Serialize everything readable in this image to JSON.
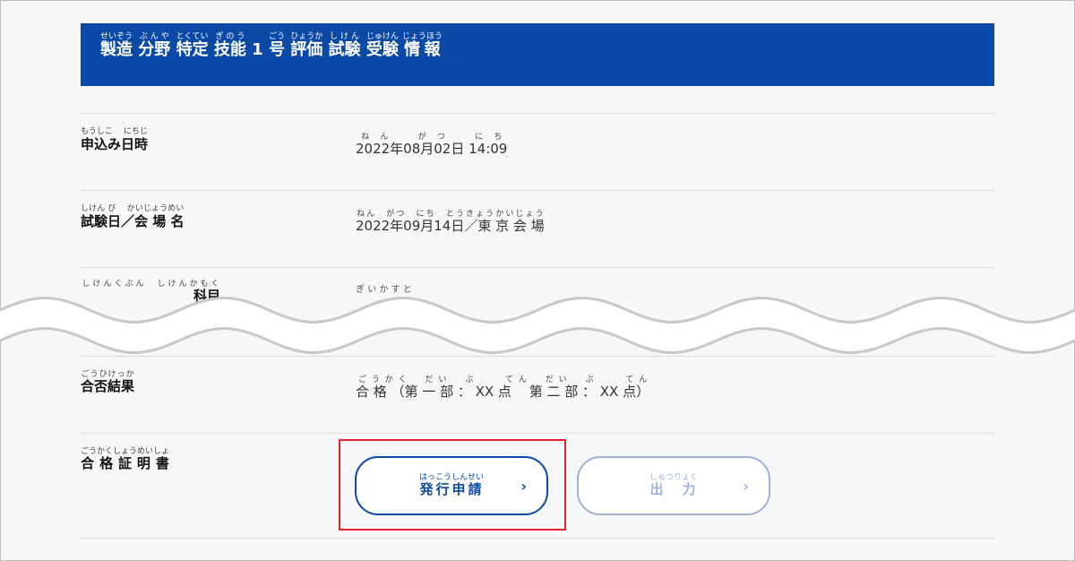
{
  "header": {
    "title_parts": [
      {
        "base": "製造",
        "rt": "せいぞう"
      },
      {
        "base": "分野",
        "rt": "ぶんや"
      },
      {
        "base": "特定",
        "rt": "とくてい"
      },
      {
        "base": "技能",
        "rt": "ぎのう"
      },
      {
        "base": "1"
      },
      {
        "base": "号",
        "rt": "ごう"
      },
      {
        "base": "評価",
        "rt": "ひょうか"
      },
      {
        "base": "試験",
        "rt": "しけん"
      },
      {
        "base": "受験",
        "rt": "じゅけん"
      },
      {
        "base": "情報",
        "rt": "じょうほう"
      }
    ]
  },
  "rows": {
    "application": {
      "label": "申込み日時",
      "label_rt": "もうしこ　 にちじ",
      "value_text": "2022年08月02日 14:09",
      "value_rt": "ねん　がつ　にち"
    },
    "exam_venue": {
      "label": "試験日／会 場 名",
      "label_rt": "しけん び　 かいじょうめい",
      "value_text": "2022年09月14日／東 京 会 場",
      "value_rt": "ねん　がつ　にち　とうきょうかいじょう"
    },
    "exam_subject": {
      "label_partial": "科目",
      "label_rt": "しけんくぶん　しけんかもく",
      "value_rt": "ぎ い か す と"
    },
    "result": {
      "label": "合否結果",
      "label_rt": "ごうひけっか",
      "value_text": "合 格 （第 一 部 ： XX 点　 第 二 部 ： XX 点）",
      "value_rt": "ごうかく　だい　ぶ　　てん　だい　ぶ　　てん"
    },
    "certificate": {
      "label": "合 格 証 明 書",
      "label_rt": "ごうかくしょうめいしょ"
    }
  },
  "buttons": {
    "issue": {
      "label": "発行申請",
      "rt": "はっこうしんせい",
      "chevron": "›"
    },
    "output": {
      "label": "出　力",
      "rt": "しゅつりょく",
      "chevron": "›"
    }
  },
  "colors": {
    "primary": "#0a49a6",
    "disabled": "#9db3d9",
    "highlight": "#e8202a",
    "background": "#f6f7f9"
  }
}
